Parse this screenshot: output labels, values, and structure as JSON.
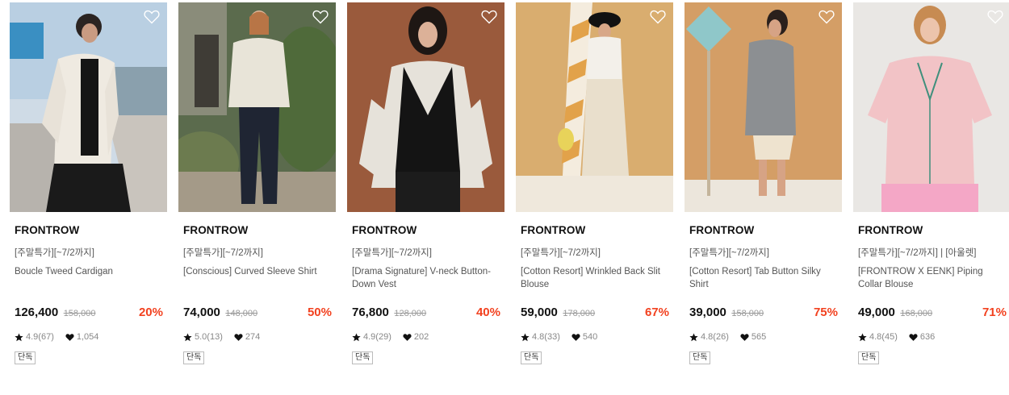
{
  "products": [
    {
      "brand": "FRONTROW",
      "promo": "[주말특가][~7/2까지]",
      "name": "Boucle Tweed Cardigan",
      "price": "126,400",
      "original_price": "158,000",
      "discount": "20%",
      "rating": "4.9(67)",
      "likes": "1,054",
      "badge": "단독"
    },
    {
      "brand": "FRONTROW",
      "promo": "[주말특가][~7/2까지]",
      "name": "[Conscious] Curved Sleeve Shirt",
      "price": "74,000",
      "original_price": "148,000",
      "discount": "50%",
      "rating": "5.0(13)",
      "likes": "274",
      "badge": "단독"
    },
    {
      "brand": "FRONTROW",
      "promo": "[주말특가][~7/2까지]",
      "name": "[Drama Signature] V-neck Button-Down Vest",
      "price": "76,800",
      "original_price": "128,000",
      "discount": "40%",
      "rating": "4.9(29)",
      "likes": "202",
      "badge": "단독"
    },
    {
      "brand": "FRONTROW",
      "promo": "[주말특가][~7/2까지]",
      "name": "[Cotton Resort] Wrinkled Back Slit Blouse",
      "price": "59,000",
      "original_price": "178,000",
      "discount": "67%",
      "rating": "4.8(33)",
      "likes": "540",
      "badge": "단독"
    },
    {
      "brand": "FRONTROW",
      "promo": "[주말특가][~7/2까지]",
      "name": "[Cotton Resort] Tab Button Silky Shirt",
      "price": "39,000",
      "original_price": "158,000",
      "discount": "75%",
      "rating": "4.8(26)",
      "likes": "565",
      "badge": "단독"
    },
    {
      "brand": "FRONTROW",
      "promo": "[주말특가][~7/2까지] | [아울렛]",
      "name": "[FRONTROW X EENK] Piping Collar Blouse",
      "price": "49,000",
      "original_price": "168,000",
      "discount": "71%",
      "rating": "4.8(45)",
      "likes": "636",
      "badge": "단독"
    }
  ],
  "colors": {
    "discount": "#f2411f",
    "price": "#111111",
    "meta": "#888888"
  },
  "icons": {
    "wishlist": "heart-outline-icon",
    "rating": "star-icon",
    "likes": "heart-filled-icon"
  }
}
